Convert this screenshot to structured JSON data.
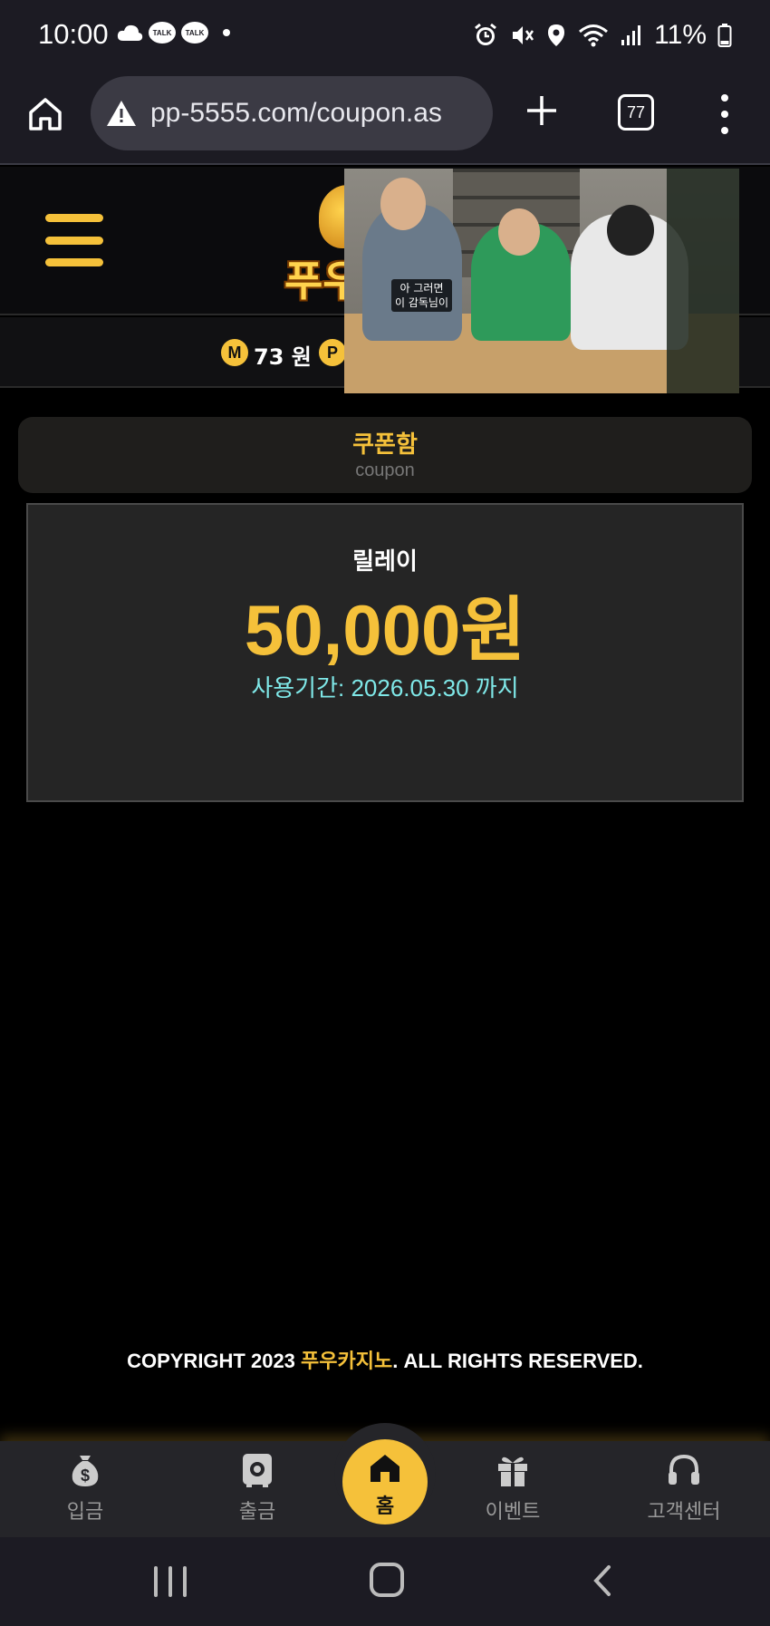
{
  "status_bar": {
    "time": "10:00",
    "notification_icons": [
      "cloud-icon",
      "kakaotalk-icon",
      "kakaotalk-icon",
      "dot-icon"
    ],
    "talk_label": "TALK",
    "system_icons": [
      "alarm-icon",
      "mute-icon",
      "location-icon",
      "wifi-icon",
      "signal-icon"
    ],
    "battery": "11%"
  },
  "browser": {
    "url": "pp-5555.com/coupon.as",
    "tab_count": "77"
  },
  "header": {
    "logo_text": "푸우"
  },
  "balance": {
    "money_badge": "M",
    "money_value": "73 원",
    "point_badge": "P"
  },
  "pip_video": {
    "caption_line1": "아 그러면",
    "caption_line2": "이 감독님이"
  },
  "coupon_section": {
    "title": "쿠폰함",
    "subtitle": "coupon"
  },
  "coupon": {
    "name": "릴레이",
    "amount": "50,000원",
    "expiry": "사용기간: 2026.05.30 까지"
  },
  "footer": {
    "copyright_prefix": "COPYRIGHT 2023 ",
    "brand": "푸우카지노",
    "copyright_suffix": ". ALL RIGHTS RESERVED."
  },
  "bottom_nav": {
    "deposit": "입금",
    "withdraw": "출금",
    "home": "홈",
    "event": "이벤트",
    "support": "고객센터"
  },
  "colors": {
    "accent": "#f5c13a",
    "expiry": "#7fe8e8",
    "background": "#000000"
  }
}
